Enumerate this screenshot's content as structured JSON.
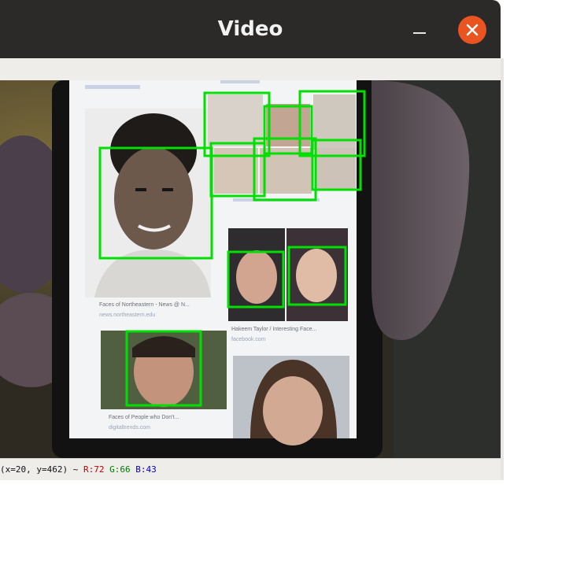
{
  "window": {
    "title": "Video"
  },
  "titlebar_icons": {
    "minimize": "minimize-icon",
    "close": "close-icon"
  },
  "colors": {
    "titlebar": "#2c2a29",
    "close_button": "#e95420",
    "detection_box": "#00ff00",
    "status_r": "#c00000",
    "status_g": "#007a00",
    "status_b": "#0000c8"
  },
  "phone_screen": {
    "caption_1": "Faces of Northeastern - News @ N...",
    "caption_1_source": "news.northeastern.edu",
    "caption_2": "Faces of People who Don't...",
    "caption_2_source": "digitaltrends.com",
    "caption_3": "Hakeem Taylor / Interesting Face...",
    "caption_3_source": "facebook.com"
  },
  "detections": {
    "count": 11
  },
  "statusbar": {
    "coords": "(x=20, y=462) ~",
    "r": "R:72",
    "g": "G:66",
    "b": "B:43"
  }
}
